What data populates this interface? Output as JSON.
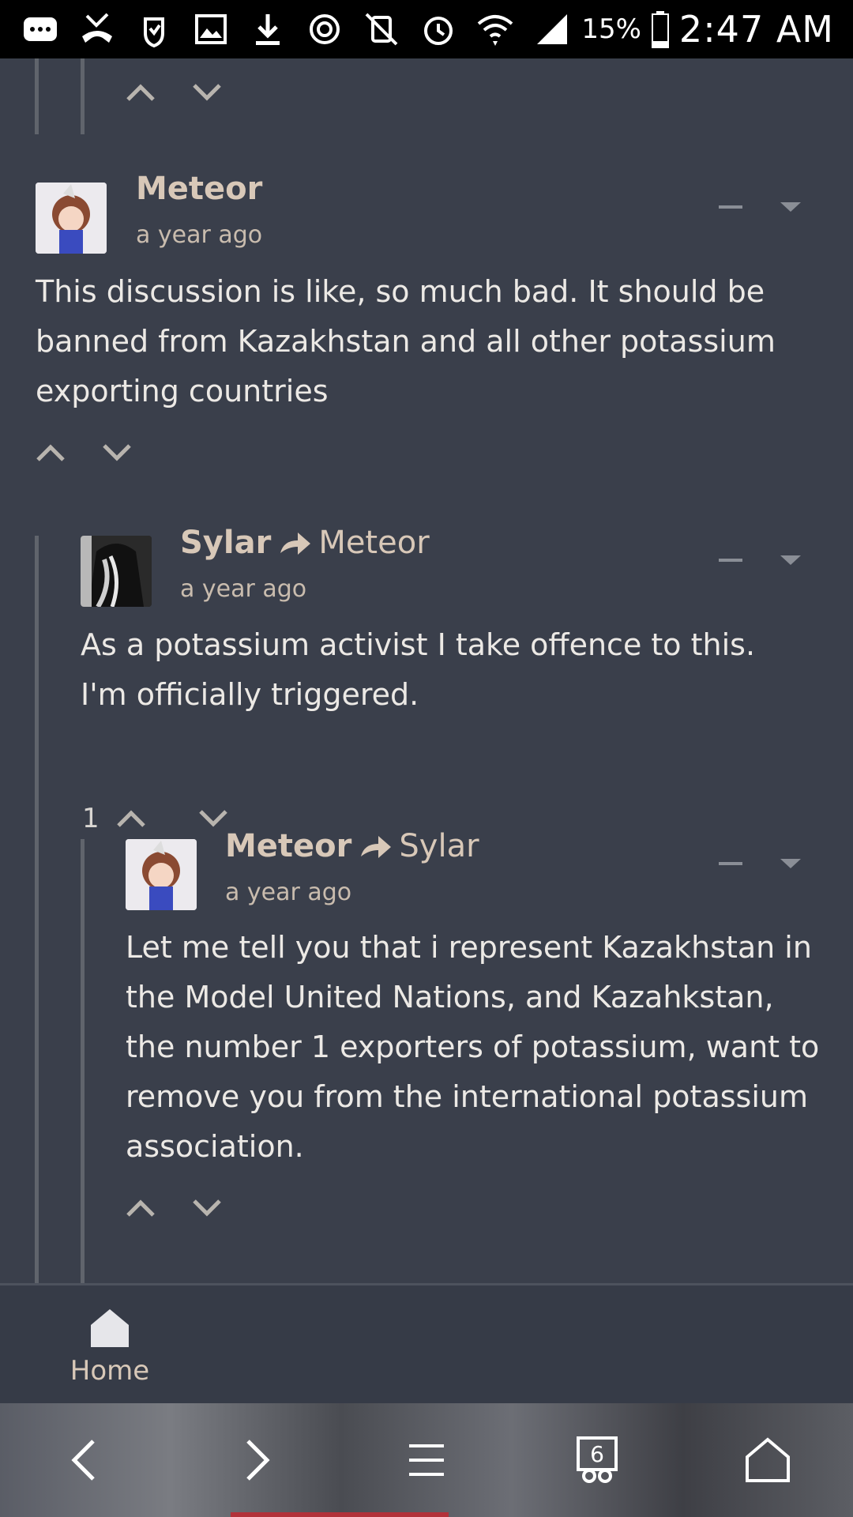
{
  "status_bar": {
    "battery_percent": "15%",
    "time": "2:47 AM",
    "icons": [
      "chat-icon",
      "missed-call-icon",
      "hand-shield-icon",
      "image-icon",
      "download-icon",
      "sync-icon",
      "mute-icon",
      "alarm-icon",
      "wifi-icon",
      "signal-icon",
      "battery-icon"
    ]
  },
  "comments": [
    {
      "author": "Meteor",
      "reply_to": "",
      "time": "a year ago",
      "body": "This discussion is like, so much bad. It should be banned from Kazakhstan and all other potassium exporting countries",
      "vote_count": ""
    },
    {
      "author": "Sylar",
      "reply_to": "Meteor",
      "time": "a year ago",
      "body": "As a potassium activist I take offence to this. I'm officially triggered.",
      "vote_count": "1"
    },
    {
      "author": "Meteor",
      "reply_to": "Sylar",
      "time": "a year ago",
      "body": "Let me tell you that i represent Kazakhstan in the Model United Nations, and Kazahkstan, the number 1 exporters of potassium, want to remove you from the international potassium association.",
      "vote_count": ""
    }
  ],
  "bottom_nav": {
    "home_label": "Home"
  },
  "browser_bar": {
    "tab_count": "6"
  },
  "colors": {
    "background": "#3a3f4b",
    "author": "#d8c8b8",
    "text": "#ece9e5",
    "rail": "#60646c"
  }
}
